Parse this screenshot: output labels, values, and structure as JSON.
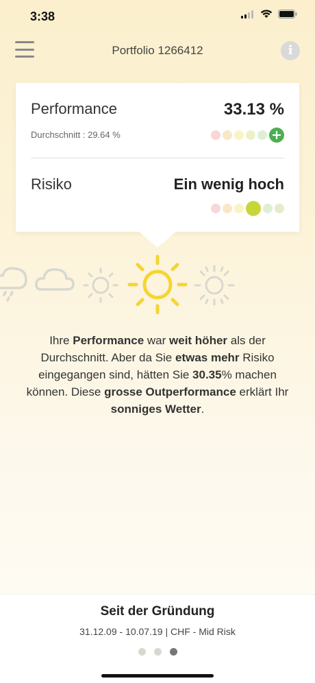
{
  "status": {
    "time": "3:38"
  },
  "nav": {
    "title": "Portfolio 1266412",
    "info_label": "i"
  },
  "performance": {
    "label": "Performance",
    "value": "33.13 %",
    "average": "Durchschnitt : 29.64 %",
    "level": 6,
    "level_scale": 6
  },
  "risk": {
    "label": "Risiko",
    "value": "Ein wenig hoch",
    "level": 4,
    "level_scale": 6
  },
  "description": {
    "p1": "Ihre ",
    "b1": "Performance",
    "p2": " war ",
    "b2": "weit höher",
    "p3": " als der Durchschnitt. Aber da Sie ",
    "b3": "etwas mehr",
    "p4": " Risiko eingegangen sind, hätten Sie ",
    "b4": "30.35",
    "p5": "% machen können. Diese ",
    "b5": "grosse Outperformance",
    "p6": " erklärt Ihr ",
    "b6": "sonniges Wetter",
    "p7": "."
  },
  "footer": {
    "title": "Seit der Gründung",
    "subtitle": "31.12.09 - 10.07.19 | CHF - Mid Risk",
    "page_index": 3,
    "page_count": 3
  },
  "colors": {
    "scale": [
      "#f8d7d7",
      "#f9e7c8",
      "#faf3c4",
      "#eef1c8",
      "#dfefd7",
      "#e3eccd"
    ],
    "perf_active": "#4caf50",
    "risk_active": "#c6d638",
    "sun": "#f5d535",
    "weather_inactive": "#d8d8d0"
  }
}
